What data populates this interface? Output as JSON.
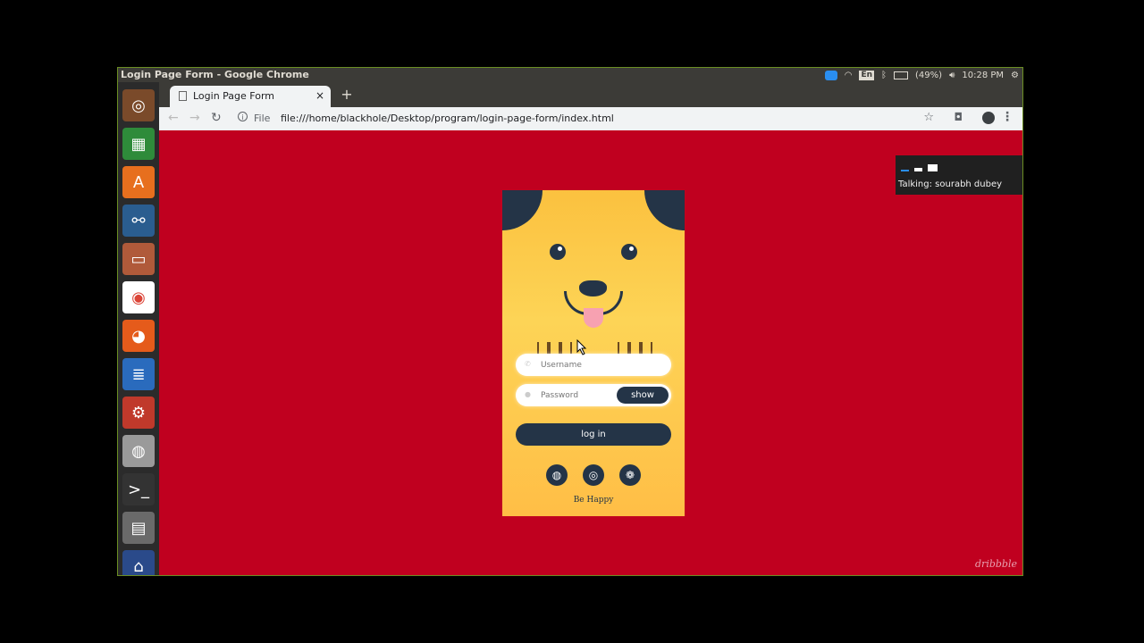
{
  "window": {
    "title": "Login Page Form - Google Chrome"
  },
  "tray": {
    "lang": "En",
    "battery": "(49%)",
    "clock": "10:28 PM"
  },
  "launcher": {
    "items": [
      {
        "name": "ubuntu-dash-icon",
        "color": "#7a4a2a",
        "glyph": "◎"
      },
      {
        "name": "spreadsheet-icon",
        "color": "#2e8b3a",
        "glyph": "▦"
      },
      {
        "name": "software-center-icon",
        "color": "#e76f1e",
        "glyph": "A"
      },
      {
        "name": "mysql-workbench-icon",
        "color": "#2a5d8f",
        "glyph": "⚯"
      },
      {
        "name": "file-manager-icon",
        "color": "#b05a3a",
        "glyph": "▭"
      },
      {
        "name": "chrome-icon",
        "color": "#ffffff",
        "glyph": "◉"
      },
      {
        "name": "firefox-icon",
        "color": "#e55b1b",
        "glyph": "◕"
      },
      {
        "name": "writer-icon",
        "color": "#2a6bbd",
        "glyph": "≣"
      },
      {
        "name": "settings-icon",
        "color": "#c0392b",
        "glyph": "⚙"
      },
      {
        "name": "disks-icon",
        "color": "#9a9a9a",
        "glyph": "◍"
      },
      {
        "name": "terminal-icon",
        "color": "#333333",
        "glyph": ">_"
      },
      {
        "name": "workspaces-icon",
        "color": "#6a6a6a",
        "glyph": "▤"
      },
      {
        "name": "trash-icon",
        "color": "#2a4a8a",
        "glyph": "⌂"
      }
    ]
  },
  "browser": {
    "tab_title": "Login Page Form",
    "tab_close": "×",
    "new_tab": "+",
    "address_prefix": "File",
    "url": "file:///home/blackhole/Desktop/program/login-page-form/index.html"
  },
  "overlay": {
    "talking": "Talking: sourabh dubey"
  },
  "form": {
    "username_placeholder": "Username",
    "password_placeholder": "Password",
    "show_label": "show",
    "login_label": "log in",
    "footer": "Be Happy"
  },
  "watermark": "dribbble"
}
